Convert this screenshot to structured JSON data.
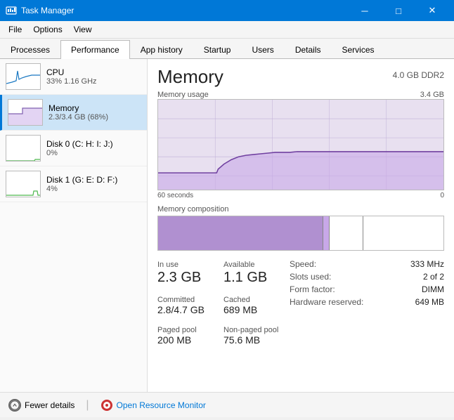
{
  "window": {
    "title": "Task Manager",
    "controls": {
      "minimize": "─",
      "maximize": "□",
      "close": "✕"
    }
  },
  "menubar": {
    "items": [
      "File",
      "Options",
      "View"
    ]
  },
  "tabs": [
    {
      "id": "processes",
      "label": "Processes"
    },
    {
      "id": "performance",
      "label": "Performance",
      "active": true
    },
    {
      "id": "app-history",
      "label": "App history"
    },
    {
      "id": "startup",
      "label": "Startup"
    },
    {
      "id": "users",
      "label": "Users"
    },
    {
      "id": "details",
      "label": "Details"
    },
    {
      "id": "services",
      "label": "Services"
    }
  ],
  "sidebar": {
    "items": [
      {
        "id": "cpu",
        "name": "CPU",
        "value": "33% 1.16 GHz",
        "active": false
      },
      {
        "id": "memory",
        "name": "Memory",
        "value": "2.3/3.4 GB (68%)",
        "active": true
      },
      {
        "id": "disk0",
        "name": "Disk 0 (C: H: I: J:)",
        "value": "0%",
        "active": false
      },
      {
        "id": "disk1",
        "name": "Disk 1 (G: E: D: F:)",
        "value": "4%",
        "active": false
      }
    ]
  },
  "memory": {
    "title": "Memory",
    "spec": "4.0 GB DDR2",
    "chart": {
      "label": "Memory usage",
      "max_label": "3.4 GB",
      "time_left": "60 seconds",
      "time_right": "0"
    },
    "composition_label": "Memory composition",
    "stats": {
      "in_use_label": "In use",
      "in_use_value": "2.3 GB",
      "available_label": "Available",
      "available_value": "1.1 GB",
      "committed_label": "Committed",
      "committed_value": "2.8/4.7 GB",
      "cached_label": "Cached",
      "cached_value": "689 MB",
      "paged_label": "Paged pool",
      "paged_value": "200 MB",
      "nonpaged_label": "Non-paged pool",
      "nonpaged_value": "75.6 MB"
    },
    "right_stats": {
      "speed_label": "Speed:",
      "speed_value": "333 MHz",
      "slots_label": "Slots used:",
      "slots_value": "2 of 2",
      "form_label": "Form factor:",
      "form_value": "DIMM",
      "hw_label": "Hardware reserved:",
      "hw_value": "649 MB"
    }
  },
  "bottom": {
    "fewer_details": "Fewer details",
    "open_resource_monitor": "Open Resource Monitor"
  }
}
